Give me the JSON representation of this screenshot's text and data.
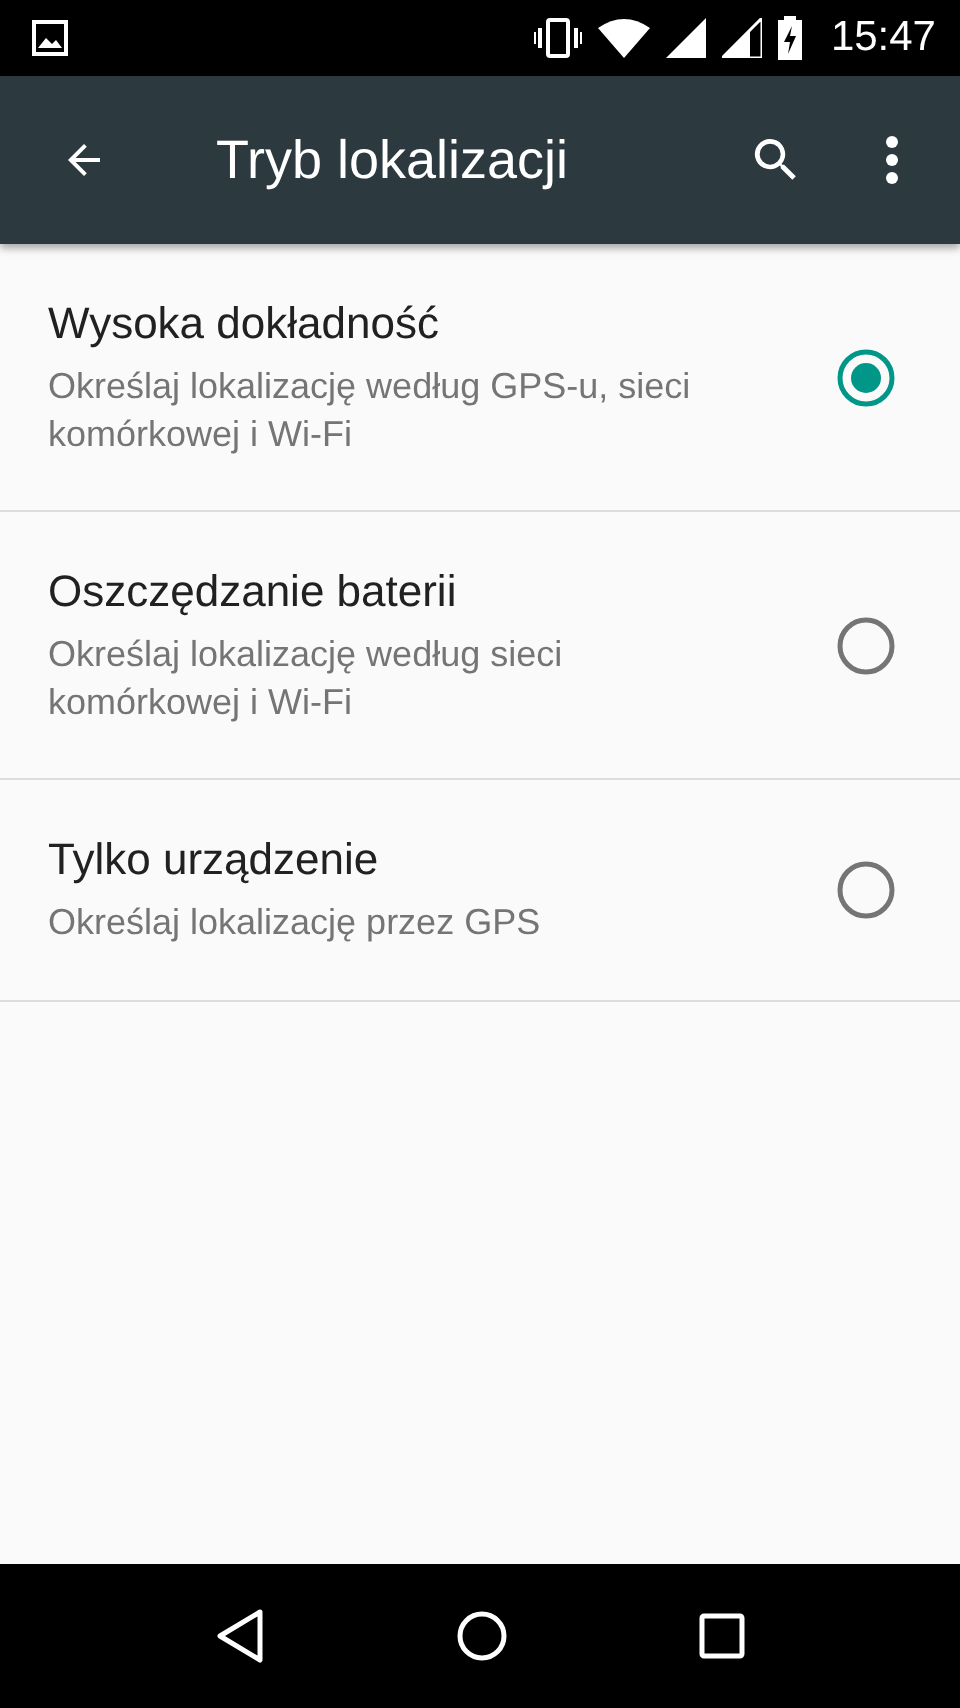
{
  "status_bar": {
    "time": "15:47"
  },
  "app_bar": {
    "title": "Tryb lokalizacji"
  },
  "options": [
    {
      "title": "Wysoka dokładność",
      "subtitle": "Określaj lokalizację według GPS-u, sieci komórkowej i Wi-Fi",
      "selected": true
    },
    {
      "title": "Oszczędzanie baterii",
      "subtitle": "Określaj lokalizację według sieci komórkowej i Wi-Fi",
      "selected": false
    },
    {
      "title": "Tylko urządzenie",
      "subtitle": "Określaj lokalizację przez GPS",
      "selected": false
    }
  ]
}
